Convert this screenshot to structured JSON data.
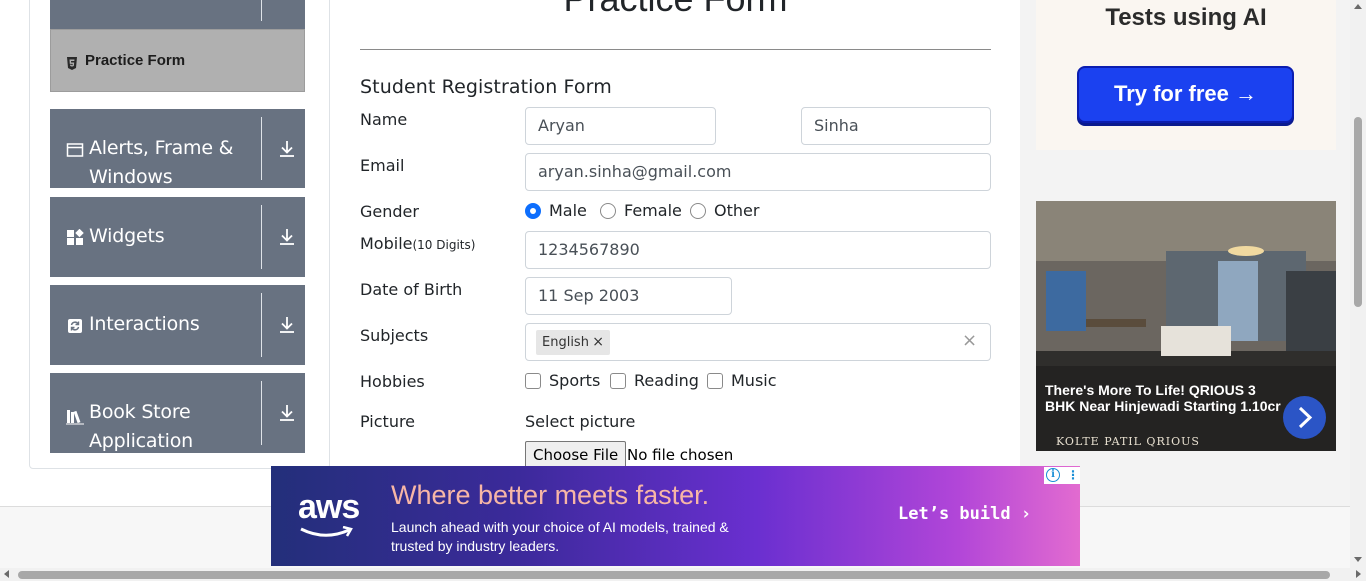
{
  "sidebar": {
    "active_item": {
      "label": "Practice Form",
      "icon": "html5-icon"
    },
    "groups": [
      {
        "label": "Alerts, Frame & Windows",
        "icon": "window-icon"
      },
      {
        "label": "Widgets",
        "icon": "widgets-icon"
      },
      {
        "label": "Interactions",
        "icon": "refresh-icon"
      },
      {
        "label": "Book Store Application",
        "icon": "books-icon"
      }
    ]
  },
  "form": {
    "page_title": "Practice Form",
    "heading": "Student Registration Form",
    "name_label": "Name",
    "first_name": "Aryan",
    "last_name": "Sinha",
    "email_label": "Email",
    "email": "aryan.sinha@gmail.com",
    "gender_label": "Gender",
    "gender_options": [
      "Male",
      "Female",
      "Other"
    ],
    "gender_selected": "Male",
    "mobile_label": "Mobile",
    "mobile_hint": "(10 Digits)",
    "mobile": "1234567890",
    "dob_label": "Date of Birth",
    "dob": "11 Sep 2003",
    "subjects_label": "Subjects",
    "subject_chip": "English",
    "chip_remove": "×",
    "clear_all": "×",
    "hobbies_label": "Hobbies",
    "hobbies": [
      "Sports",
      "Reading",
      "Music"
    ],
    "picture_label": "Picture",
    "picture_prompt": "Select picture",
    "choose_file": "Choose File",
    "file_status": "No file chosen"
  },
  "ads": {
    "top": {
      "headline": "Tests using AI",
      "button": "Try for free →"
    },
    "house": {
      "text": "There's More To Life! QRIOUS 3 BHK Near Hinjewadi Starting 1.10cr",
      "brand": "KOLTE PATIL QRIOUS"
    },
    "bottom": {
      "logo": "aws",
      "headline": "Where better meets faster.",
      "sub": "Launch ahead with your choice of AI models, trained & trusted by industry leaders.",
      "cta": "Let’s build ›",
      "info": "i",
      "more": "⋮"
    }
  },
  "colors": {
    "sidebar_group": "#687281",
    "sidebar_active": "#b0b0b0",
    "radio_checked": "#0d6efd",
    "ad_button": "#1b41f0"
  }
}
